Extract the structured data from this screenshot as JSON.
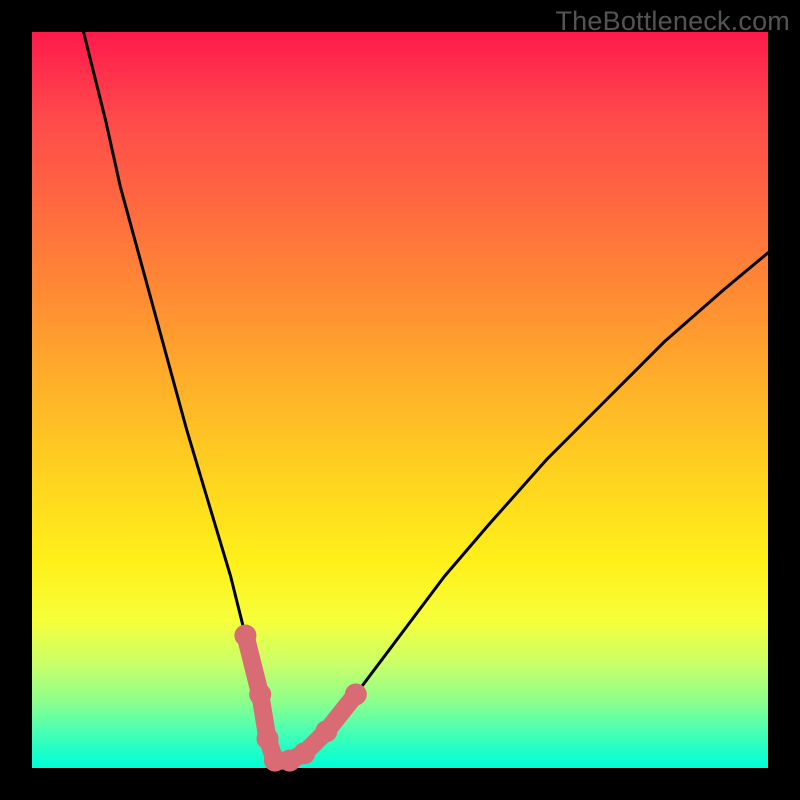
{
  "watermark": "TheBottleneck.com",
  "colors": {
    "frame_bg": "#000000",
    "watermark": "#545454",
    "curve": "#000000",
    "highlight": "#d96b75",
    "gradient_top": "#ff1a4b",
    "gradient_bottom": "#00ffd5"
  },
  "chart_data": {
    "type": "line",
    "title": "",
    "xlabel": "",
    "ylabel": "",
    "xlim": [
      0,
      100
    ],
    "ylim": [
      0,
      100
    ],
    "grid": false,
    "series": [
      {
        "name": "bottleneck-curve",
        "x": [
          7,
          10,
          12,
          15,
          18,
          21,
          24,
          27,
          29,
          31,
          32,
          33,
          35,
          37,
          40,
          44,
          50,
          56,
          62,
          70,
          78,
          86,
          94,
          100
        ],
        "values": [
          100,
          88,
          79,
          68,
          57,
          46,
          36,
          26,
          18,
          10,
          4,
          1,
          1,
          2,
          5,
          10,
          18,
          26,
          33,
          42,
          50,
          58,
          65,
          70
        ]
      }
    ],
    "highlight": {
      "name": "optimal-range",
      "x": [
        29,
        31,
        32,
        33,
        35,
        37,
        40,
        44
      ],
      "values": [
        18,
        10,
        4,
        1,
        1,
        2,
        5,
        10
      ]
    }
  }
}
